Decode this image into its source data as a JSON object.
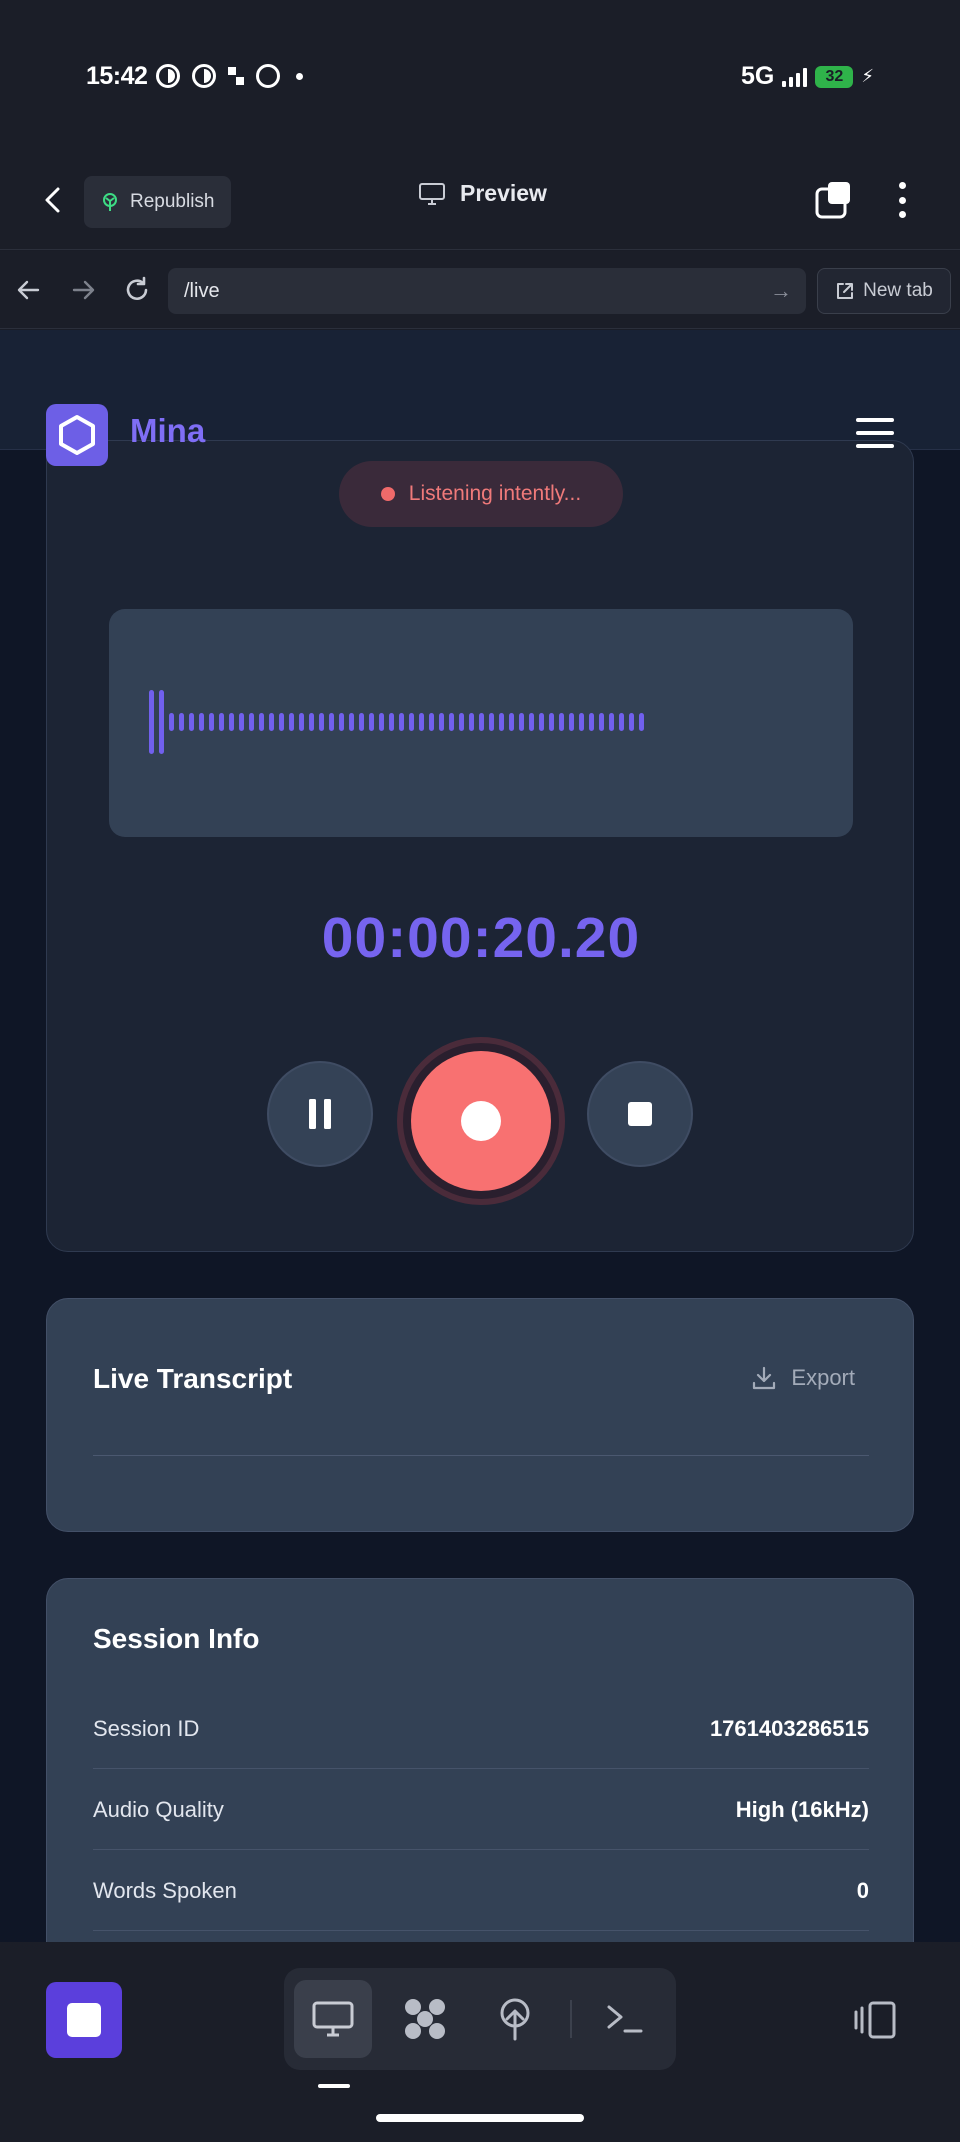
{
  "status_bar": {
    "time": "15:42",
    "network": "5G",
    "battery": "32"
  },
  "app_header": {
    "republish_label": "Republish",
    "preview_label": "Preview"
  },
  "url_bar": {
    "url": "/live",
    "new_tab_label": "New tab"
  },
  "site": {
    "brand_name": "Mina",
    "brand_color": "#7f6ef5"
  },
  "recorder": {
    "status_text": "Listening intently...",
    "timer": "00:00:20.20",
    "record_color": "#f87171",
    "waveform_color": "#7160ee"
  },
  "transcript": {
    "title": "Live Transcript",
    "export_label": "Export"
  },
  "session_info": {
    "title": "Session Info",
    "rows": [
      {
        "label": "Session ID",
        "value": "1761403286515"
      },
      {
        "label": "Audio Quality",
        "value": "High (16kHz)"
      },
      {
        "label": "Words Spoken",
        "value": "0"
      }
    ]
  },
  "bottom_toolbar": {
    "tools": [
      "desktop-icon",
      "apps-icon",
      "publish-icon",
      "terminal-icon"
    ],
    "accent": "#5b3fdc"
  }
}
